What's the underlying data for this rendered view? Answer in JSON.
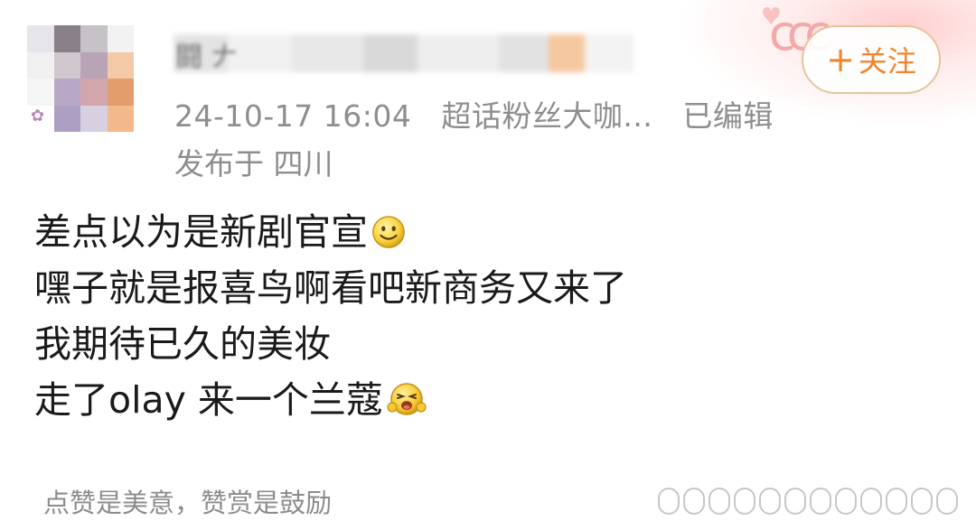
{
  "post": {
    "timestamp": "24-10-17 16:04",
    "source": "超话粉丝大咖...",
    "edited": "已编辑",
    "location_prefix": "发布于",
    "location": "四川",
    "lines": [
      "差点以为是新剧官宣",
      "嘿子就是报喜鸟啊看吧新商务又来了",
      "我期待已久的美妆",
      "走了olay 来一个兰蔻"
    ],
    "footer": "点赞是美意，赞赏是鼓励"
  },
  "follow_button": {
    "plus": "+",
    "label": "关注"
  },
  "colors": {
    "accent": "#f0852d",
    "meta_text": "#8e8e8e",
    "body_text": "#1a1a1a"
  },
  "icons": {
    "line1_emoji": "smile-emoji-icon",
    "line4_emoji": "wink-emoji-icon"
  }
}
